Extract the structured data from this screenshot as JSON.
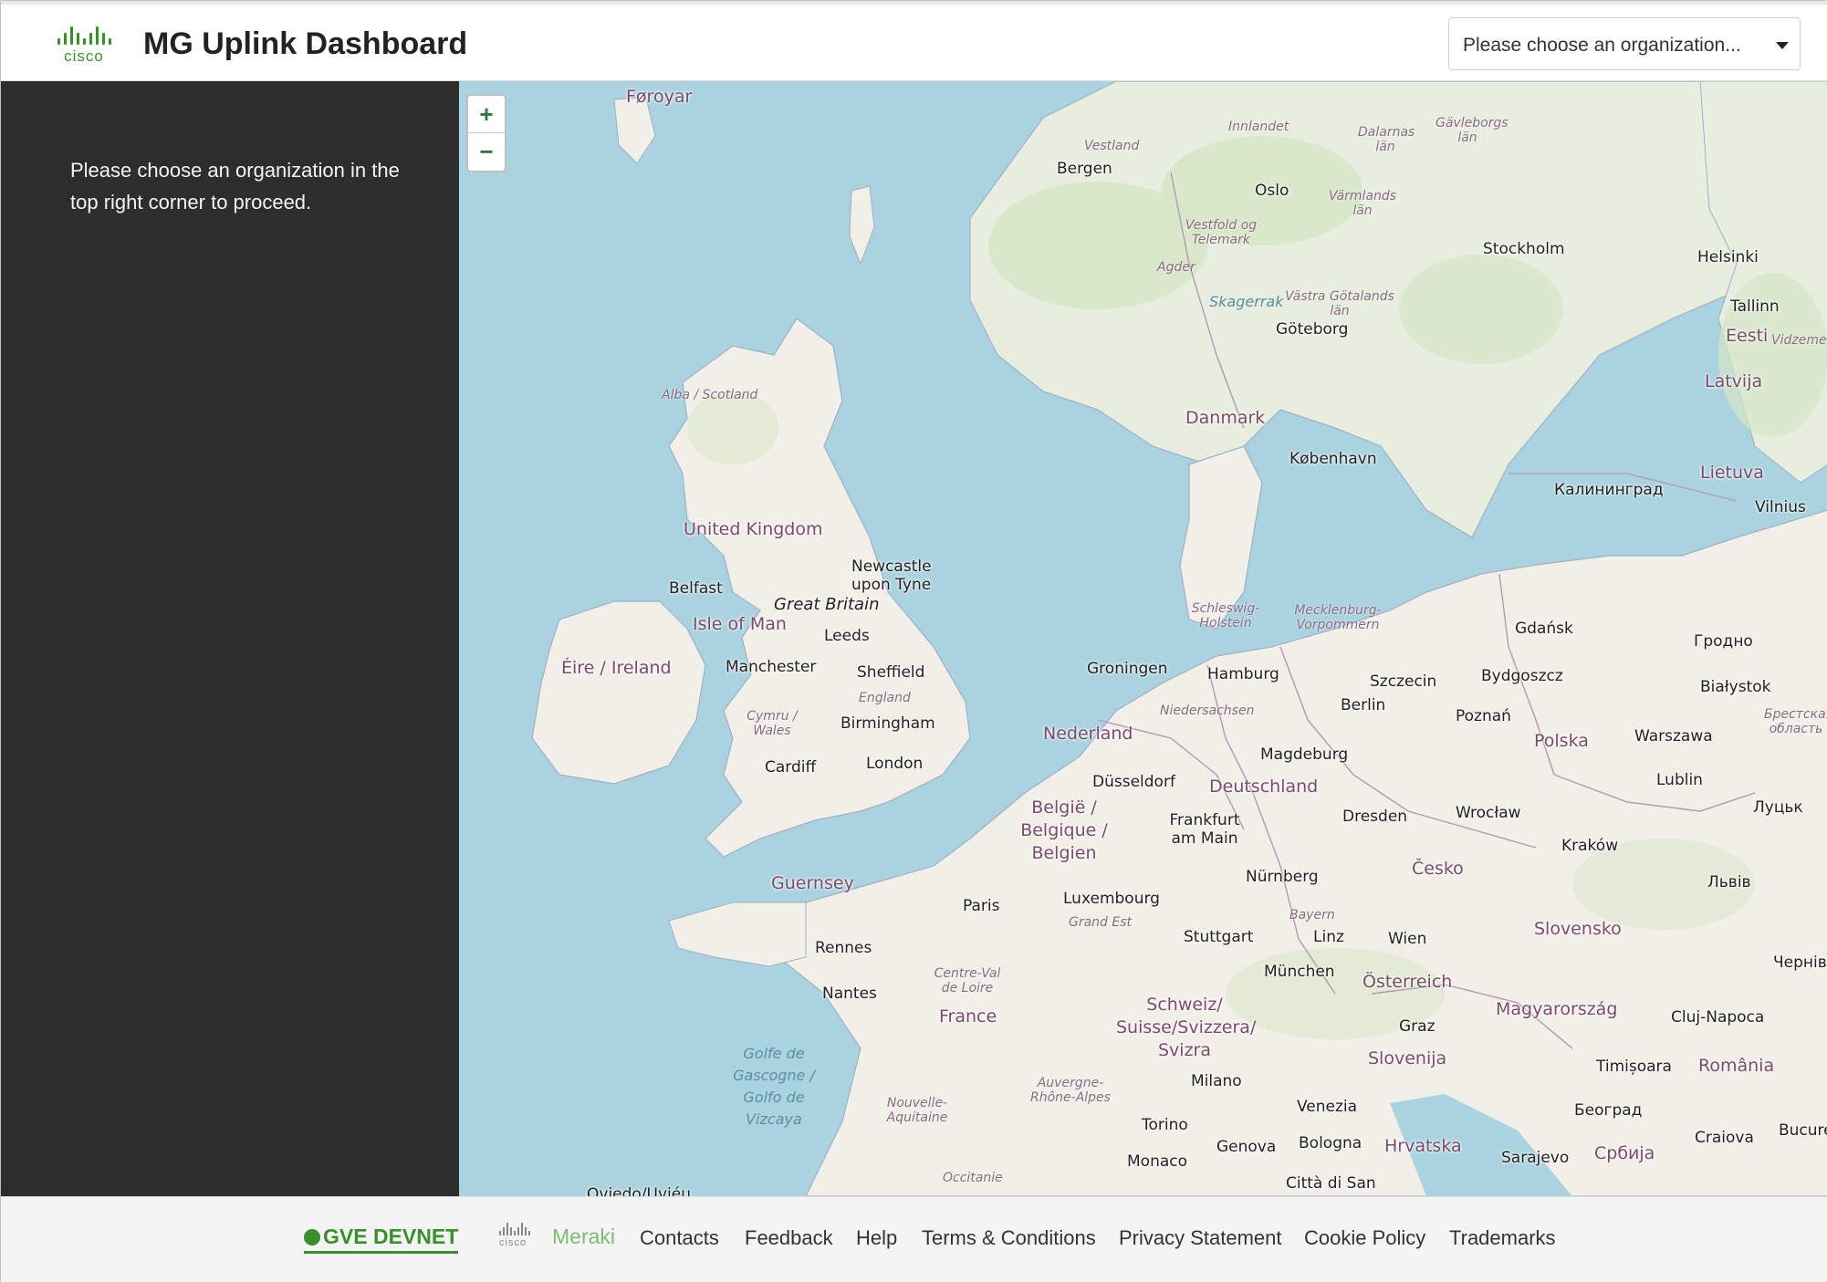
{
  "header": {
    "logo_text": "cisco",
    "title": "MG Uplink Dashboard",
    "org_select": {
      "placeholder": "Please choose an organization..."
    }
  },
  "sidebar": {
    "message": "Please choose an organization in the top right corner to proceed."
  },
  "map": {
    "zoom_in": "+",
    "zoom_out": "−",
    "labels": {
      "foroyar": "Føroyar",
      "vestland": "Vestland",
      "bergen": "Bergen",
      "innlandet": "Innlandet",
      "dalarnas": "Dalarnas län",
      "gavleborgs": "Gävleborgs län",
      "oslo": "Oslo",
      "varmlands": "Värmlands län",
      "vestfold": "Vestfold og Telemark",
      "agder": "Agder",
      "stockholm": "Stockholm",
      "helsinki": "Helsinki",
      "tallinn": "Tallinn",
      "eesti": "Eesti",
      "skagerrak": "Skagerrak",
      "vastra": "Västra Götalands län",
      "goteborg": "Göteborg",
      "vidzeme": "Vidzeme",
      "latvija": "Latvija",
      "alba": "Alba / Scotland",
      "danmark": "Danmark",
      "kobenhavn": "København",
      "lietuva": "Lietuva",
      "kaliningrad": "Калининград",
      "vilnius": "Vilnius",
      "uk": "United Kingdom",
      "newcastle": "Newcastle upon Tyne",
      "belfast": "Belfast",
      "great_britain": "Great Britain",
      "isle_of_man": "Isle of Man",
      "leeds": "Leeds",
      "schleswig": "Schleswig-Holstein",
      "mecklenburg": "Mecklenburg-Vorpommern",
      "gdansk": "Gdańsk",
      "grodno": "Гродно",
      "eire": "Éire / Ireland",
      "manchester": "Manchester",
      "sheffield": "Sheffield",
      "groningen": "Groningen",
      "hamburg": "Hamburg",
      "szczecin": "Szczecin",
      "bydgoszcz": "Bydgoszcz",
      "bialystok": "Białystok",
      "england": "England",
      "berlin": "Berlin",
      "cymru": "Cymru / Wales",
      "birmingham": "Birmingham",
      "niedersachsen": "Niedersachsen",
      "poznan": "Poznań",
      "brest": "Брестская область",
      "nederland": "Nederland",
      "polska": "Polska",
      "warszawa": "Warszawa",
      "magdeburg": "Magdeburg",
      "cardiff": "Cardiff",
      "london": "London",
      "lublin": "Lublin",
      "dusseldorf": "Düsseldorf",
      "deutschland": "Deutschland",
      "lutsk": "Луцьк",
      "belgie": "België / Belgique / Belgien",
      "frankfurt": "Frankfurt am Main",
      "dresden": "Dresden",
      "wroclaw": "Wrocław",
      "krakow": "Kraków",
      "cesko": "Česko",
      "lviv": "Львів",
      "guernsey": "Guernsey",
      "nurnberg": "Nürnberg",
      "luxembourg": "Luxembourg",
      "paris": "Paris",
      "bayern": "Bayern",
      "grand_est": "Grand Est",
      "stuttgart": "Stuttgart",
      "linz": "Linz",
      "wien": "Wien",
      "slovensko": "Slovensko",
      "chernivtsi": "Чернівці",
      "rennes": "Rennes",
      "munchen": "München",
      "osterreich": "Österreich",
      "centre": "Centre-Val de Loire",
      "nantes": "Nantes",
      "schweiz": "Schweiz/ Suisse/Svizzera/ Svizra",
      "magyarorszag": "Magyarország",
      "cluj": "Cluj-Napoca",
      "france": "France",
      "graz": "Graz",
      "golfe": "Golfe de Gascogne / Golfo de Vizcaya",
      "slovenija": "Slovenija",
      "timisoara": "Timișoara",
      "romania": "România",
      "milano": "Milano",
      "auvergne": "Auvergne-Rhône-Alpes",
      "nouvelle": "Nouvelle-Aquitaine",
      "venezia": "Venezia",
      "beograd": "Београд",
      "torino": "Torino",
      "genova": "Genova",
      "bologna": "Bologna",
      "hrvatska": "Hrvatska",
      "craiova": "Craiova",
      "bucuresti": "Bucureș",
      "sarajevo": "Sarajevo",
      "srbija": "Србија",
      "monaco": "Monaco",
      "occitanie": "Occitanie",
      "citta": "Città di San",
      "oviedo": "Oviedo/Uviéu"
    }
  },
  "footer": {
    "gve": "GVE DEVNET",
    "meraki_cisco": "cisco",
    "meraki": "Meraki",
    "links": [
      "Contacts",
      "Feedback",
      "Help",
      "Terms & Conditions",
      "Privacy Statement",
      "Cookie Policy",
      "Trademarks"
    ]
  },
  "colors": {
    "accent": "#3a8f2a",
    "sidebar": "#2d2d2d",
    "water": "#aad3df",
    "land": "#f2efe9"
  }
}
